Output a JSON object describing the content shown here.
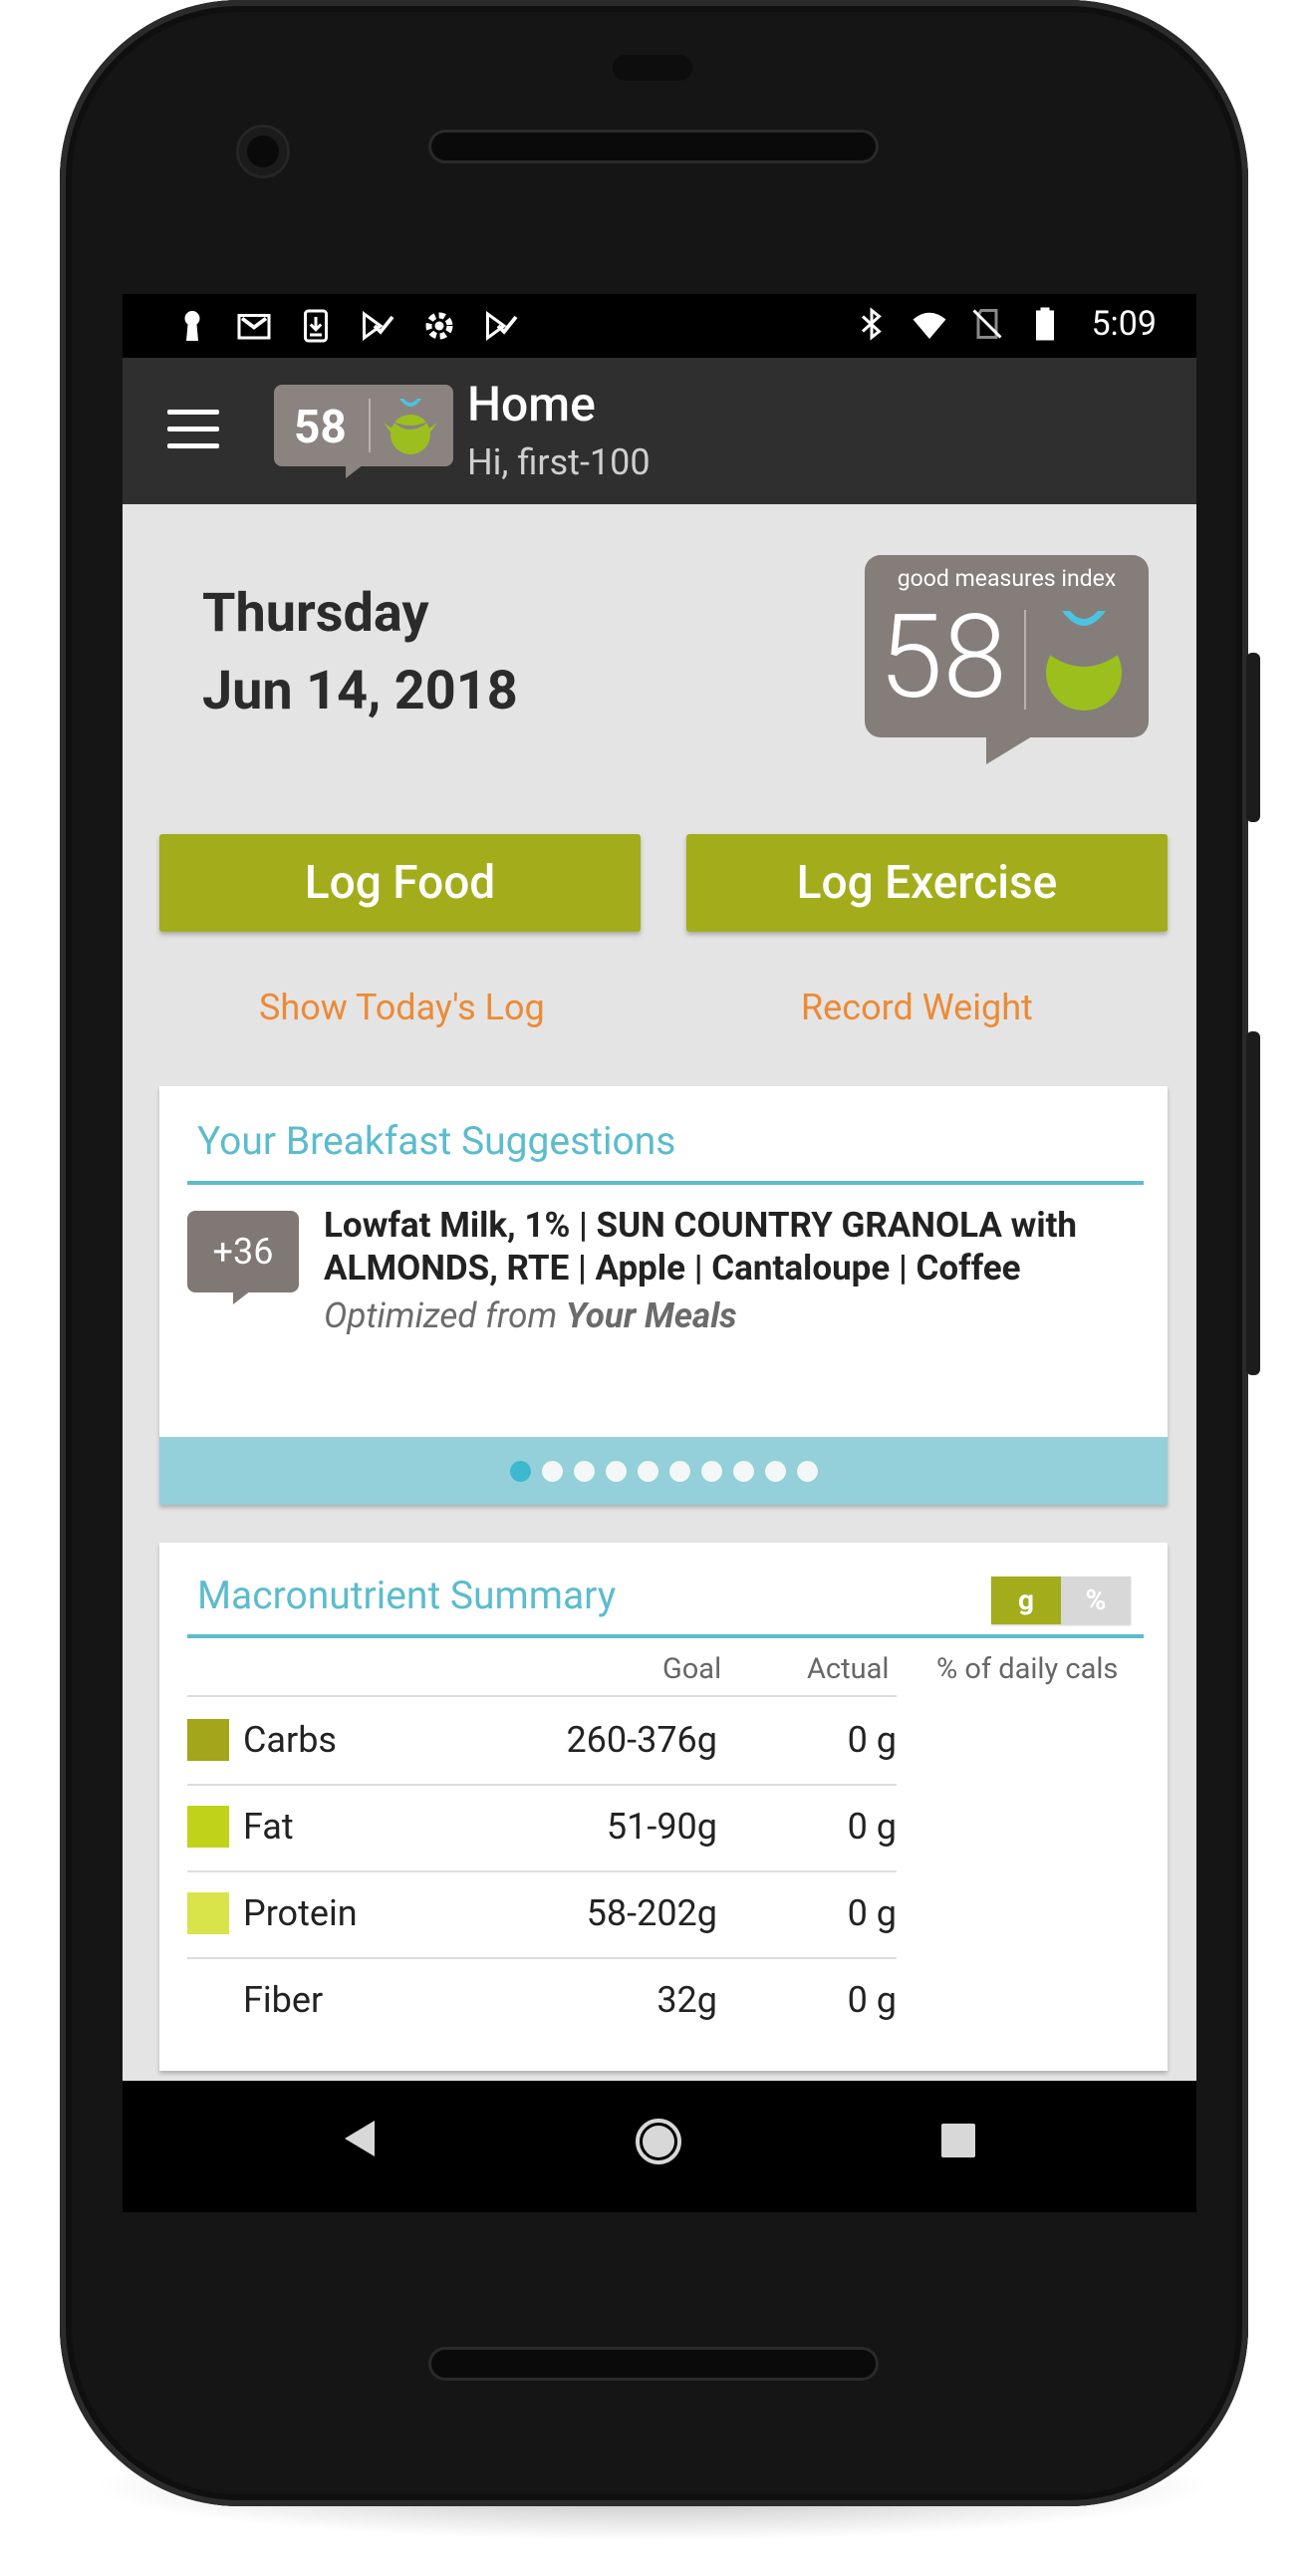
{
  "status_bar": {
    "left_icons": [
      "keyhole-icon",
      "gmail-icon",
      "download-icon",
      "checklist-icon",
      "settings-cog-icon",
      "checklist-icon"
    ],
    "right_icons": [
      "bluetooth-icon",
      "wifi-icon",
      "no-sim-icon",
      "battery-icon"
    ],
    "time": "5:09"
  },
  "app_bar": {
    "badge_score": "58",
    "title": "Home",
    "subtitle": "Hi, first-100"
  },
  "date": {
    "weekday": "Thursday",
    "date": "Jun 14, 2018"
  },
  "gmi": {
    "label": "good measures index",
    "score": "58"
  },
  "actions": {
    "log_food": "Log Food",
    "log_exercise": "Log Exercise",
    "show_log": "Show Today's Log",
    "record_weight": "Record Weight"
  },
  "breakfast": {
    "title": "Your Breakfast Suggestions",
    "score_delta": "+36",
    "items": "Lowfat Milk, 1% | SUN COUNTRY GRANOLA with ALMONDS, RTE | Apple | Cantaloupe | Coffee",
    "optimized_prefix": "Optimized from",
    "optimized_source": "Your Meals",
    "page_count": 10,
    "active_page": 0
  },
  "macro": {
    "title": "Macronutrient Summary",
    "toggle_g": "g",
    "toggle_pct": "%",
    "headers": {
      "goal": "Goal",
      "actual": "Actual",
      "pct": "% of daily cals"
    },
    "rows": [
      {
        "name": "Carbs",
        "goal": "260-376g",
        "actual": "0 g",
        "color": "#a3a51a"
      },
      {
        "name": "Fat",
        "goal": "51-90g",
        "actual": "0 g",
        "color": "#c1d21a"
      },
      {
        "name": "Protein",
        "goal": "58-202g",
        "actual": "0 g",
        "color": "#d9e34a"
      },
      {
        "name": "Fiber",
        "goal": "32g",
        "actual": "0 g",
        "color": ""
      }
    ]
  },
  "colors": {
    "accent_green": "#a3ad1b",
    "accent_teal": "#5bbccd",
    "link_orange": "#ec8a35",
    "badge_gray": "#847d7a"
  }
}
